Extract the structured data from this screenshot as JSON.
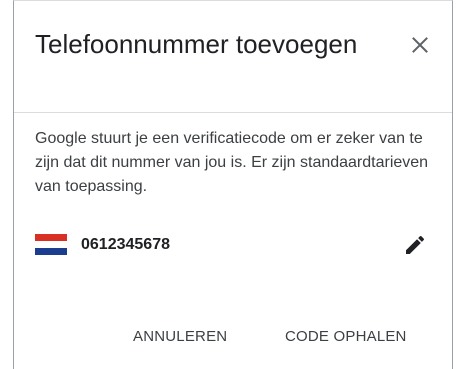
{
  "dialog": {
    "title": "Telefoonnummer toevoegen",
    "description": "Google stuurt je een verificatiecode om er zeker van te zijn dat dit nummer van jou is. Er zijn standaardtarieven van toepassing.",
    "phone_number": "0612345678",
    "country_flag": "netherlands-flag-icon",
    "close_icon": "close-icon",
    "edit_icon": "pencil-icon",
    "cancel_label": "ANNULEREN",
    "get_code_label": "CODE OPHALEN"
  }
}
